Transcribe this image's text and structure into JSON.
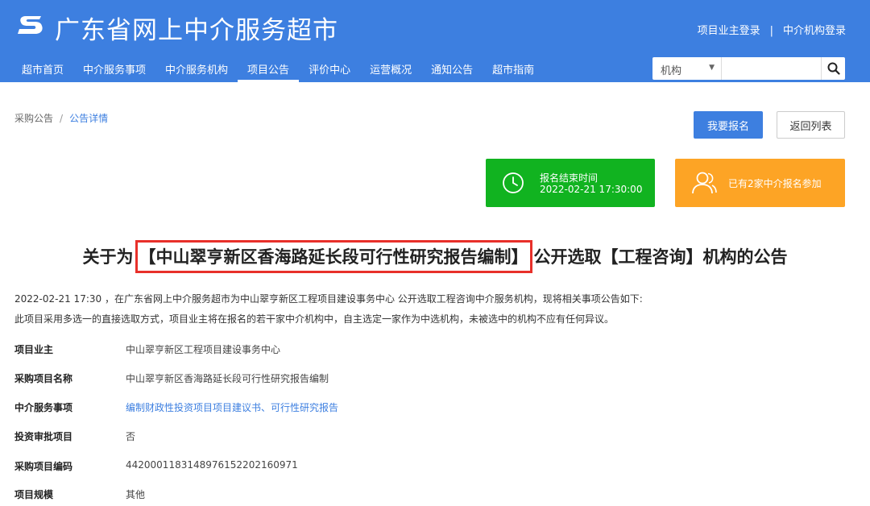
{
  "header": {
    "logo_icon": "s-logo-icon",
    "site_title": "广东省网上中介服务超市",
    "owner_login": "项目业主登录",
    "auth_separator": "|",
    "agency_login": "中介机构登录",
    "background_color": "#3d7fe0"
  },
  "nav": {
    "items": [
      {
        "label": "超市首页"
      },
      {
        "label": "中介服务事项"
      },
      {
        "label": "中介服务机构"
      },
      {
        "label": "项目公告"
      },
      {
        "label": "评价中心"
      },
      {
        "label": "运营概况"
      },
      {
        "label": "通知公告"
      },
      {
        "label": "超市指南"
      }
    ],
    "active_label": "项目公告"
  },
  "search": {
    "category_selected": "机构",
    "query": "",
    "button_icon": "search-icon"
  },
  "breadcrumb": {
    "root": "采购公告",
    "separator": "/",
    "current": "公告详情"
  },
  "actions": {
    "signup_label": "我要报名",
    "back_label": "返回列表",
    "primary_color": "#3d7fe0"
  },
  "status_cards": {
    "deadline_label": "报名结束时间",
    "deadline_value": "2022-02-21 17:30:00",
    "deadline_icon": "clock-icon",
    "deadline_color": "#11b320",
    "count_text": "已有2家中介报名参加",
    "count_icon": "users-icon",
    "count_color": "#fda425"
  },
  "notice": {
    "title_prefix": "关于为",
    "title_highlight": "【中山翠亨新区香海路延长段可行性研究报告编制】",
    "title_suffix": "公开选取【工程咨询】机构的公告",
    "highlight_color": "#e8302a",
    "intro_1": "2022-02-21 17:30 ，在广东省网上中介服务超市为中山翠亨新区工程项目建设事务中心 公开选取工程咨询中介服务机构，现将相关事项公告如下:",
    "intro_2": "此项目采用多选一的直接选取方式，项目业主将在报名的若干家中介机构中，自主选定一家作为中选机构，未被选中的机构不应有任何异议。"
  },
  "details": [
    {
      "key": "项目业主",
      "value": "中山翠亨新区工程项目建设事务中心"
    },
    {
      "key": "采购项目名称",
      "value": "中山翠亨新区香海路延长段可行性研究报告编制"
    },
    {
      "key": "中介服务事项",
      "value": "编制财政性投资项目项目建议书、可行性研究报告"
    },
    {
      "key": "投资审批项目",
      "value": "否"
    },
    {
      "key": "采购项目编码",
      "value": "442000118314897615220216097​1"
    },
    {
      "key": "项目规模",
      "value": "其他"
    }
  ]
}
